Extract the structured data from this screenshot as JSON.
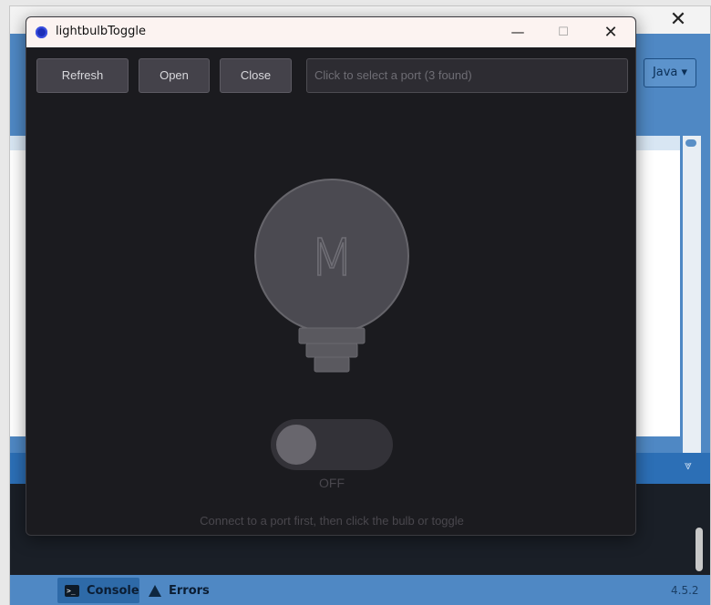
{
  "ide": {
    "mode_label": "Java ▾",
    "console_tab": "Console",
    "errors_tab": "Errors",
    "version": "4.5.2",
    "close_glyph": "✕"
  },
  "window": {
    "title": "lightbulbToggle",
    "minimize_glyph": "—",
    "maximize_glyph": "☐",
    "close_glyph": "✕"
  },
  "toolbar": {
    "refresh_label": "Refresh",
    "open_label": "Open",
    "close_label": "Close",
    "port_placeholder": "Click to select a port  (3 found)"
  },
  "bulb": {
    "glyph": "M",
    "state": "off",
    "colors": {
      "bulb": "#4b4a51",
      "bulb_stroke": "#66656b",
      "base": "#5a595f"
    }
  },
  "toggle": {
    "label": "OFF",
    "on": false
  },
  "hint": "Connect to a port first, then click the bulb or toggle",
  "colors": {
    "window_bg": "#1b1b1f",
    "button_bg": "#44424a",
    "ide_blue": "#4f88c4"
  }
}
